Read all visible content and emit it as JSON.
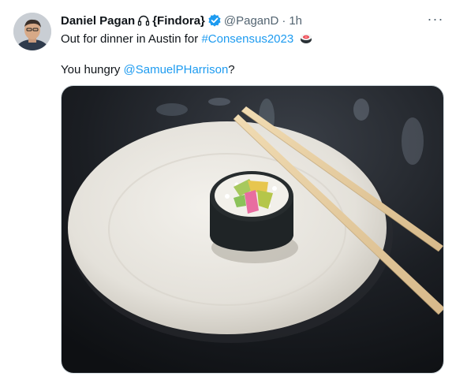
{
  "tweet": {
    "display_name": "Daniel Pagan",
    "name_suffix": "{Findora}",
    "handle": "@PaganD",
    "separator": "·",
    "time": "1h",
    "text_line1_prefix": "Out for dinner in Austin for ",
    "hashtag": "#Consensus2023",
    "text_line2_prefix": "You hungry ",
    "mention": "@SamuelPHarrison",
    "text_line2_suffix": "?",
    "more_label": "···"
  },
  "icons": {
    "avatar": "avatar",
    "headphones": "headphones-icon",
    "verified": "verified-badge-icon",
    "sushi_emoji": "sushi-emoji-icon",
    "more": "more-options-icon"
  },
  "colors": {
    "link": "#1d9bf0",
    "verified": "#1d9bf0",
    "muted": "#536471"
  },
  "media": {
    "type": "photo"
  }
}
